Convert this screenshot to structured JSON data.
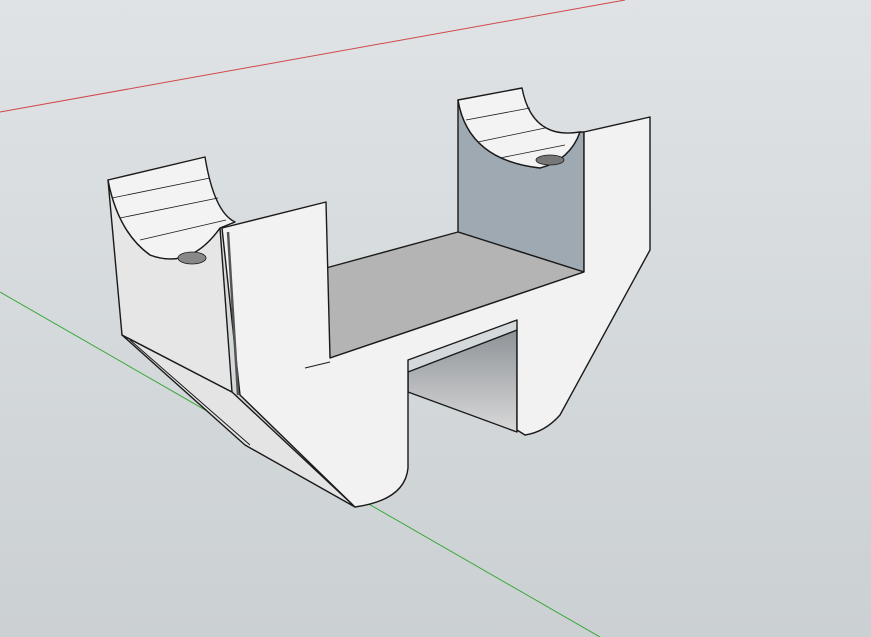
{
  "viewport": {
    "background_top": "#dfe3e5",
    "background_bottom": "#cbd0d3"
  },
  "axes": {
    "red_axis_color": "#d0484a",
    "green_axis_color": "#3aa83a"
  },
  "model": {
    "face_color": "#f2f2f2",
    "side_color": "#e6e6e6",
    "inner_face_color": "#9ea9b2",
    "floor_color": "#b4b4b4",
    "edge_color": "#1a1a1a"
  }
}
